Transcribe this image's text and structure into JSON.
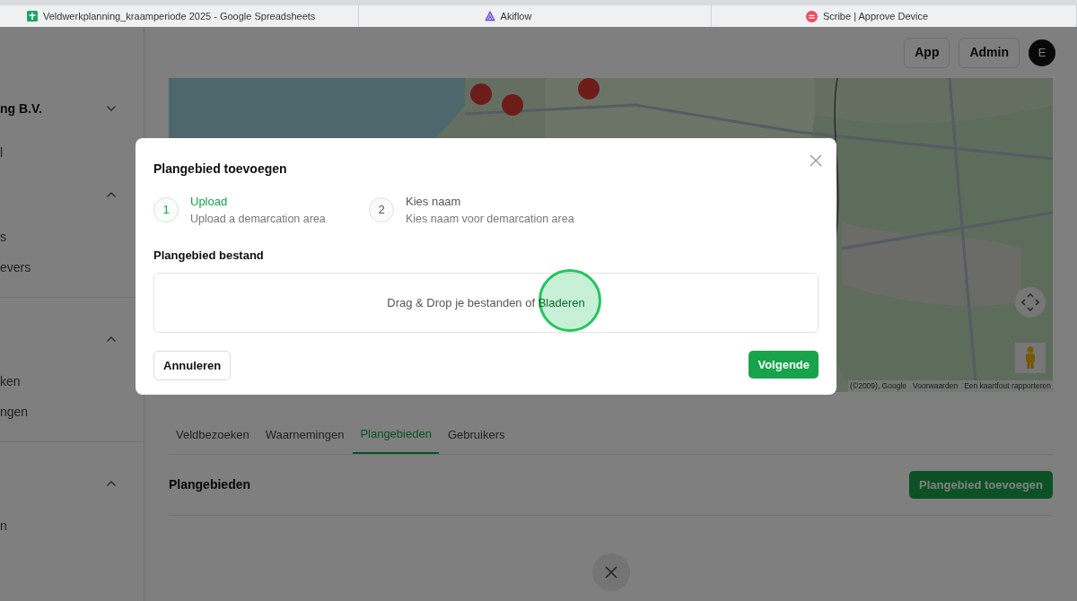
{
  "browser_tabs": [
    {
      "title": "Veldwerkplanning_kraamperiode 2025 - Google Spreadsheets",
      "kind": "sheets"
    },
    {
      "title": "Akiflow",
      "kind": "akiflow"
    },
    {
      "title": "Scribe | Approve Device",
      "kind": "scribe"
    }
  ],
  "header": {
    "buttons": [
      "App",
      "Admin"
    ],
    "avatar": "E"
  },
  "sidebar": [
    {
      "kind": "org",
      "label": "ng B.V.",
      "expanded": false
    },
    {
      "kind": "item",
      "label": "l"
    },
    {
      "kind": "section",
      "expanded": true
    },
    {
      "kind": "item",
      "label": "s"
    },
    {
      "kind": "item",
      "label": "evers"
    },
    {
      "kind": "divider"
    },
    {
      "kind": "section",
      "expanded": true
    },
    {
      "kind": "item",
      "label": "ken"
    },
    {
      "kind": "item",
      "label": "ngen"
    },
    {
      "kind": "divider"
    },
    {
      "kind": "section",
      "expanded": true
    },
    {
      "kind": "item",
      "label": "n"
    }
  ],
  "map": {
    "attribution": [
      "(©2009), Google",
      "Voorwaarden",
      "Een kaartfout rapporteren"
    ]
  },
  "tabs": [
    {
      "label": "Veldbezoeken",
      "selected": false
    },
    {
      "label": "Waarnemingen",
      "selected": false
    },
    {
      "label": "Plangebieden",
      "selected": true
    },
    {
      "label": "Gebruikers",
      "selected": false
    }
  ],
  "section": {
    "title": "Plangebieden",
    "button": "Plangebied toevoegen"
  },
  "modal": {
    "title": "Plangebied toevoegen",
    "steps": [
      {
        "number": "1",
        "title": "Upload",
        "subtitle": "Upload a demarcation area",
        "selected": true
      },
      {
        "number": "2",
        "title": "Kies naam",
        "subtitle": "Kies naam voor demarcation area",
        "selected": false
      }
    ],
    "field_label": "Plangebied bestand",
    "dropzone": {
      "text": "Drag & Drop je bestanden of ",
      "link": "Bladeren"
    },
    "cancel": "Annuleren",
    "next": "Volgende"
  }
}
